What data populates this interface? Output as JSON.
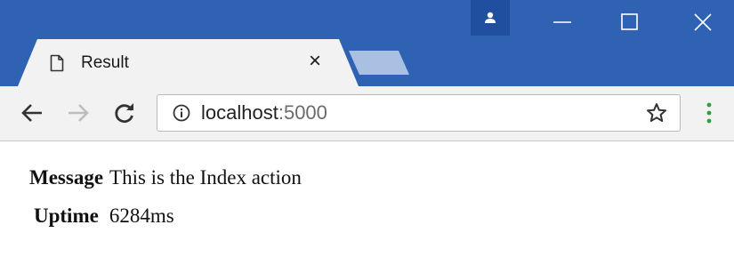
{
  "tab": {
    "title": "Result",
    "close_glyph": "×"
  },
  "address_bar": {
    "host": "localhost",
    "port": ":5000"
  },
  "icons": {
    "tab_page": "page-icon",
    "back": "arrow-left-icon",
    "forward": "arrow-right-icon",
    "reload": "reload-icon",
    "info": "info-icon",
    "bookmark": "star-icon",
    "menu": "kebab-menu-icon",
    "profile": "person-icon",
    "minimize": "minimize-icon",
    "maximize": "maximize-icon",
    "close": "close-icon"
  },
  "colors": {
    "titlebar": "#2f62b3",
    "profile_button": "#1f4f9e",
    "tab_background": "#f2f2f2",
    "menu_dots": "#2e9e3e"
  },
  "page": {
    "rows": [
      {
        "key": "Message",
        "value": "This is the Index action"
      },
      {
        "key": "Uptime",
        "value": "6284ms"
      }
    ]
  }
}
